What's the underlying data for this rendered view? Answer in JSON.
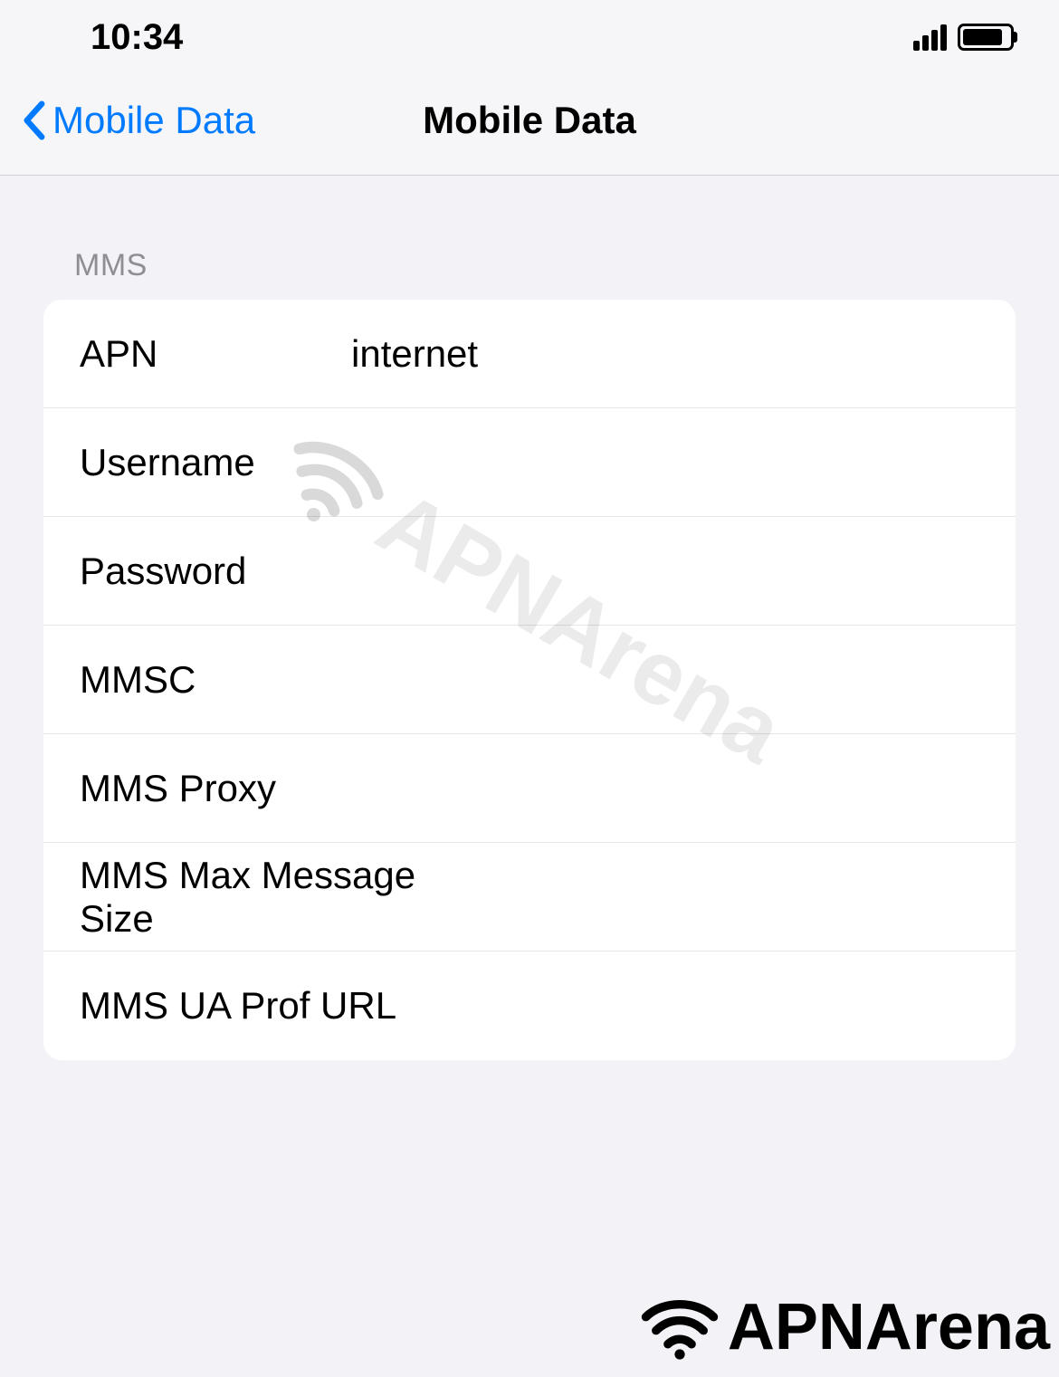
{
  "statusBar": {
    "time": "10:34"
  },
  "navBar": {
    "backLabel": "Mobile Data",
    "title": "Mobile Data"
  },
  "section": {
    "header": "MMS",
    "rows": [
      {
        "label": "APN",
        "value": "internet"
      },
      {
        "label": "Username",
        "value": ""
      },
      {
        "label": "Password",
        "value": ""
      },
      {
        "label": "MMSC",
        "value": ""
      },
      {
        "label": "MMS Proxy",
        "value": ""
      },
      {
        "label": "MMS Max Message Size",
        "value": ""
      },
      {
        "label": "MMS UA Prof URL",
        "value": ""
      }
    ]
  },
  "watermark": {
    "text": "APNArena"
  },
  "footer": {
    "brand": "APNArena"
  }
}
